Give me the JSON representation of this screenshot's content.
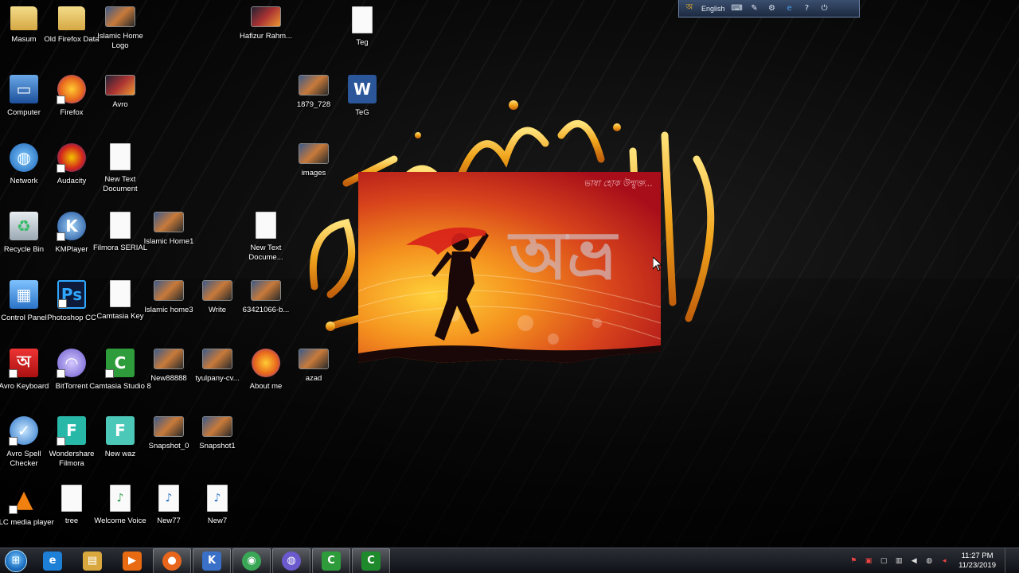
{
  "desktop": {
    "icons": [
      {
        "label": "Masum",
        "icon": "folder-icon"
      },
      {
        "label": "Old Firefox Data",
        "icon": "folder-icon"
      },
      {
        "label": "Islamic Home Logo",
        "icon": "image-icon"
      },
      {
        "label": "Hafizur Rahm...",
        "icon": "video-icon"
      },
      {
        "label": "Teg",
        "icon": "text-file-icon"
      },
      {
        "label": "Computer",
        "icon": "computer-icon"
      },
      {
        "label": "Firefox",
        "icon": "firefox-icon"
      },
      {
        "label": "Avro",
        "icon": "video-icon"
      },
      {
        "label": "1879_728",
        "icon": "image-icon"
      },
      {
        "label": "TeG",
        "icon": "word-doc-icon"
      },
      {
        "label": "Network",
        "icon": "network-icon"
      },
      {
        "label": "Audacity",
        "icon": "audacity-icon"
      },
      {
        "label": "New Text Document",
        "icon": "text-file-icon"
      },
      {
        "label": "images",
        "icon": "image-icon"
      },
      {
        "label": "Recycle Bin",
        "icon": "recycle-bin-icon"
      },
      {
        "label": "KMPlayer",
        "icon": "kmplayer-icon"
      },
      {
        "label": "Filmora SERIAL",
        "icon": "text-file-icon"
      },
      {
        "label": "Islamic Home1",
        "icon": "image-icon"
      },
      {
        "label": "New Text Docume...",
        "icon": "text-file-icon"
      },
      {
        "label": "Control Panel",
        "icon": "control-panel-icon"
      },
      {
        "label": "Photoshop CC",
        "icon": "photoshop-icon"
      },
      {
        "label": "Camtasia Key",
        "icon": "text-file-icon"
      },
      {
        "label": "Islamic home3",
        "icon": "image-icon"
      },
      {
        "label": "Write",
        "icon": "image-icon"
      },
      {
        "label": "63421066-b...",
        "icon": "image-icon"
      },
      {
        "label": "Avro Keyboard",
        "icon": "avro-keyboard-icon"
      },
      {
        "label": "BitTorrent",
        "icon": "bittorrent-icon"
      },
      {
        "label": "Camtasia Studio 8",
        "icon": "camtasia-icon"
      },
      {
        "label": "New88888",
        "icon": "image-icon"
      },
      {
        "label": "tyulpany-cv...",
        "icon": "image-icon"
      },
      {
        "label": "About me",
        "icon": "firefox-doc-icon"
      },
      {
        "label": "azad",
        "icon": "image-icon"
      },
      {
        "label": "Avro Spell Checker",
        "icon": "spellcheck-icon"
      },
      {
        "label": "Wondershare Filmora",
        "icon": "filmora-icon"
      },
      {
        "label": "New waz",
        "icon": "filmora-doc-icon"
      },
      {
        "label": "Snapshot_0",
        "icon": "image-icon"
      },
      {
        "label": "Snapshot1",
        "icon": "image-icon"
      },
      {
        "label": "VLC media player",
        "icon": "vlc-icon"
      },
      {
        "label": "tree",
        "icon": "text-file-icon"
      },
      {
        "label": "Welcome Voice",
        "icon": "audio-file-icon"
      },
      {
        "label": "New77",
        "icon": "wav-file-icon"
      },
      {
        "label": "New7",
        "icon": "mp3-file-icon"
      }
    ]
  },
  "language_bar": {
    "language": "English"
  },
  "splash": {
    "tagline": "ভাষা হোক উন্মুক্ত...",
    "logo_text": "অভ্র"
  },
  "taskbar": {
    "pinned": [
      {
        "name": "internet-explorer",
        "label": "e",
        "color": "#1d7fd6"
      },
      {
        "name": "file-explorer",
        "label": "▤",
        "color": "#d8a83e"
      },
      {
        "name": "media-player",
        "label": "▶",
        "color": "#e86a12"
      },
      {
        "name": "firefox",
        "label": "●",
        "color": "#e8661c"
      },
      {
        "name": "kmplayer",
        "label": "K",
        "color": "#3a70c8"
      },
      {
        "name": "chrome",
        "label": "◉",
        "color": "#3aa757"
      },
      {
        "name": "bittorrent",
        "label": "◍",
        "color": "#6a5acd"
      },
      {
        "name": "camtasia-studio",
        "label": "C",
        "color": "#2e9c3a"
      },
      {
        "name": "camtasia-recorder",
        "label": "C",
        "color": "#1f8a2c"
      }
    ],
    "clock": {
      "time": "11:27 PM",
      "date": "11/23/2019"
    }
  },
  "colors": {
    "taskbar_bg": "#15181e",
    "splash_red": "#a80e1a",
    "splash_orange": "#f4901e",
    "calligraphy_gold": "#f0b020"
  }
}
